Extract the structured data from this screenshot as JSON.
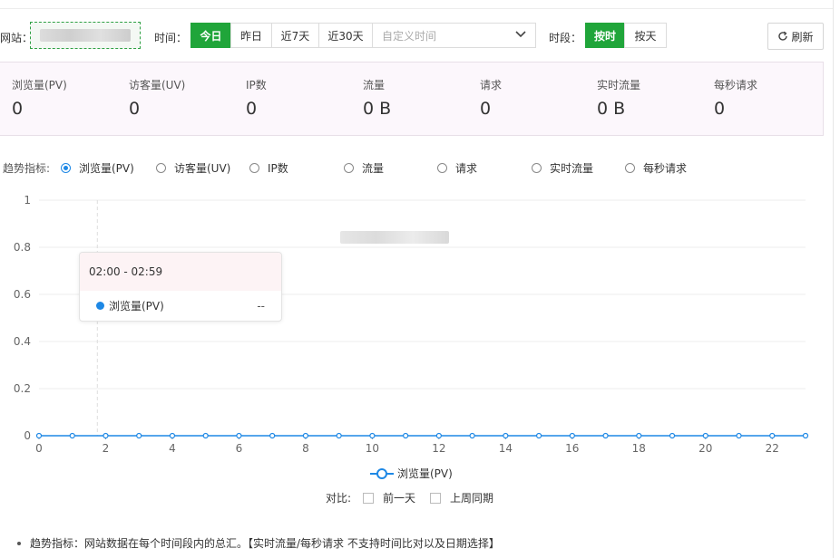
{
  "toolbar": {
    "site_label": "网站：",
    "time_label": "时间：",
    "time_options": [
      "今日",
      "昨日",
      "近7天",
      "近30天"
    ],
    "time_active": "今日",
    "custom_time_placeholder": "自定义时间",
    "period_label": "时段：",
    "period_options": [
      "按时",
      "按天"
    ],
    "period_active": "按时",
    "refresh_label": "刷新"
  },
  "stats": [
    {
      "label": "浏览量(PV)",
      "value": "0"
    },
    {
      "label": "访客量(UV)",
      "value": "0"
    },
    {
      "label": "IP数",
      "value": "0"
    },
    {
      "label": "流量",
      "value": "0 B"
    },
    {
      "label": "请求",
      "value": "0"
    },
    {
      "label": "实时流量",
      "value": "0 B"
    },
    {
      "label": "每秒请求",
      "value": "0"
    }
  ],
  "trend": {
    "label": "趋势指标:",
    "options": [
      "浏览量(PV)",
      "访客量(UV)",
      "IP数",
      "流量",
      "请求",
      "实时流量",
      "每秒请求"
    ],
    "selected": "浏览量(PV)"
  },
  "tooltip": {
    "title": "02:00 - 02:59",
    "series": "浏览量(PV)",
    "value": "--"
  },
  "compare": {
    "label": "对比:",
    "options": [
      "前一天",
      "上周同期"
    ]
  },
  "note": "趋势指标：网站数据在每个时间段内的总汇。【实时流量/每秒请求 不支持时间比对以及日期选择】",
  "colors": {
    "accent_green": "#20a53a",
    "series_blue": "#1e88e5"
  },
  "chart_data": {
    "type": "line",
    "x": [
      0,
      1,
      2,
      3,
      4,
      5,
      6,
      7,
      8,
      9,
      10,
      11,
      12,
      13,
      14,
      15,
      16,
      17,
      18,
      19,
      20,
      21,
      22,
      23
    ],
    "xticks": [
      "0",
      "2",
      "4",
      "6",
      "8",
      "10",
      "12",
      "14",
      "16",
      "18",
      "20",
      "22"
    ],
    "yticks": [
      "0",
      "0.2",
      "0.4",
      "0.6",
      "0.8",
      "1"
    ],
    "series": [
      {
        "name": "浏览量(PV)",
        "values": [
          0,
          0,
          0,
          0,
          0,
          0,
          0,
          0,
          0,
          0,
          0,
          0,
          0,
          0,
          0,
          0,
          0,
          0,
          0,
          0,
          0,
          0,
          0,
          0
        ]
      }
    ],
    "xlim": [
      0,
      23
    ],
    "ylim": [
      0,
      1
    ],
    "grid": true,
    "legend": "bottom"
  }
}
